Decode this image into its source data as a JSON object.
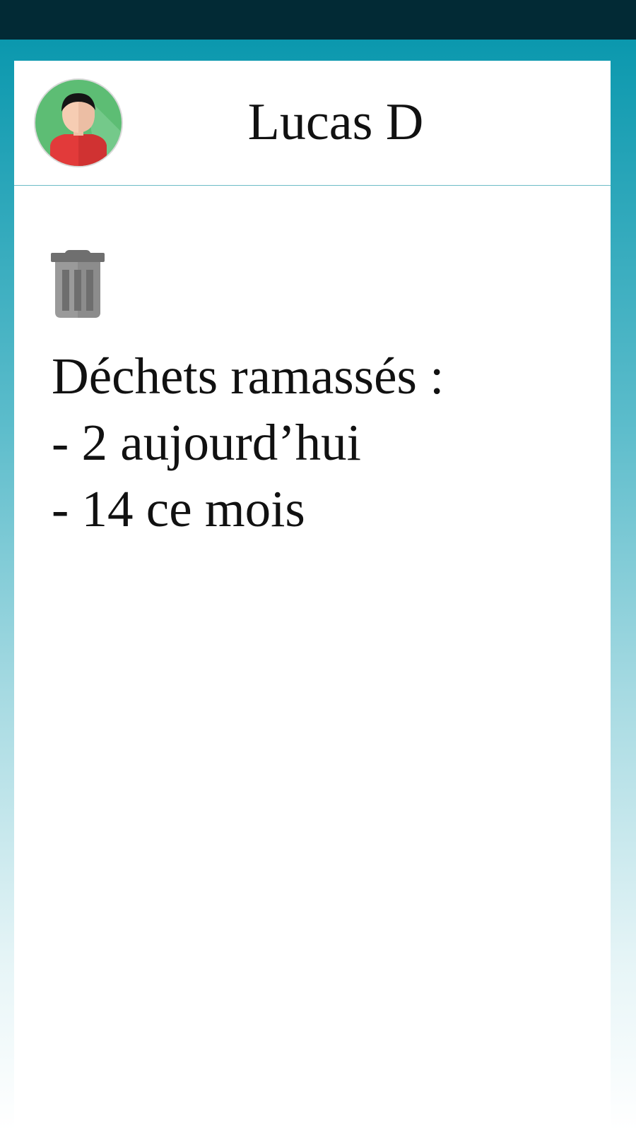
{
  "colors": {
    "status_bar": "#022a35",
    "accent": "#0b98ae",
    "divider": "#6cbcc6"
  },
  "profile": {
    "avatar_icon": "user-avatar-icon",
    "name": "Lucas D"
  },
  "stats": {
    "icon": "trash-icon",
    "heading": "Déchets ramassés :",
    "today": "- 2 aujourd’hui",
    "month": "- 14 ce mois"
  }
}
